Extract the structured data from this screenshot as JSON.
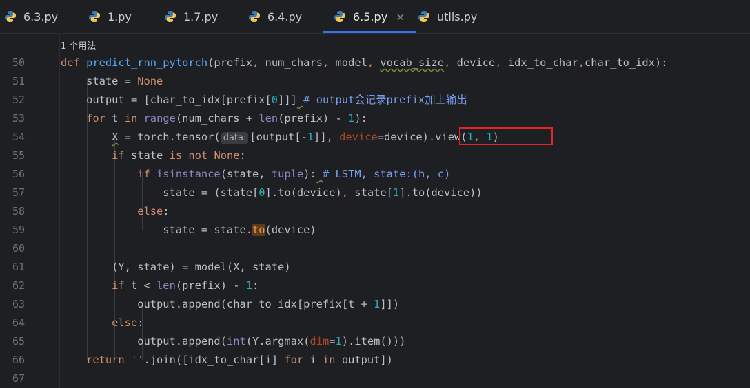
{
  "tabs": [
    {
      "label": "6.3.py",
      "active": false
    },
    {
      "label": "1.py",
      "active": false
    },
    {
      "label": "1.7.py",
      "active": false
    },
    {
      "label": "6.4.py",
      "active": false
    },
    {
      "label": "6.5.py",
      "active": true
    },
    {
      "label": "utils.py",
      "active": false
    }
  ],
  "close_icon": "×",
  "editor": {
    "usage_hint": "1 个用法",
    "line_numbers": [
      "50",
      "51",
      "52",
      "53",
      "54",
      "55",
      "56",
      "57",
      "58",
      "59",
      "60",
      "61",
      "62",
      "63",
      "64",
      "65",
      "66",
      "67"
    ],
    "lines": {
      "l50": {
        "kw": "def",
        "fn": "predict_rnn_pytorch",
        "p1": "(prefix",
        "c1": ", ",
        "a2": "num_chars",
        "c2": ", ",
        "a3": "model",
        "c3": ", ",
        "a4": "vocab_size",
        "c4": ", ",
        "a5": "device",
        "c5": ", ",
        "a6": "idx_to_char",
        "c6": ",",
        "a7": "char_to_idx",
        "end": "):"
      },
      "l51": {
        "a": "state = ",
        "b": "None"
      },
      "l52": {
        "a": "output = [char_to_idx[prefix[",
        "n": "0",
        "b": "]]]",
        "sp": " ",
        "c": "# output会记录prefix加上输出"
      },
      "l53": {
        "k1": "for",
        "a": " t ",
        "k2": "in",
        "s": " ",
        "b1": "range",
        "c": "(num_chars + ",
        "b2": "len",
        "d": "(prefix) - ",
        "n": "1",
        "e": "):"
      },
      "l54": {
        "a": "X",
        "b": " = torch.tensor(",
        "hint": "data:",
        "c": "[output[-",
        "n": "1",
        "d": "]]",
        "e": ", ",
        "f": "device",
        "g": "=device)",
        ".v": ".view(",
        "n1": "1",
        "cm": ", ",
        "n2": "1",
        "end": ")"
      },
      "l55": {
        "k": "if",
        "a": " state ",
        "k2": "is not",
        "s": " ",
        "k3": "None",
        "b": ":"
      },
      "l56": {
        "k": "if",
        "s": " ",
        "b": "isinstance",
        "c": "(state, ",
        "d": "tuple",
        "e": "):",
        "sp": " ",
        "f": "# LSTM, state:(h, c)"
      },
      "l57": {
        "a": "state = (state[",
        "n": "0",
        "b": "].to(device)",
        "c": ", ",
        "d": "state[",
        "n2": "1",
        "e": "].to(device))"
      },
      "l58": {
        "k": "else",
        "b": ":"
      },
      "l59": {
        "a": "state = state.",
        "h": "to",
        "b": "(device)"
      },
      "l60": {},
      "l61": {
        "a": "(Y, state) = model(X, state)"
      },
      "l62": {
        "k": "if",
        "a": " t < ",
        "b": "len",
        "c": "(prefix) - ",
        "n": "1",
        "d": ":"
      },
      "l63": {
        "a": "output.append(char_to_idx[prefix[t + ",
        "n": "1",
        "b": "]])"
      },
      "l64": {
        "k": "else",
        "b": ":"
      },
      "l65": {
        "a": "output.append(",
        "b": "int",
        "c": "(Y.argmax(",
        "d": "dim",
        "e": "=",
        "n": "1",
        "f": ").item()))"
      },
      "l66": {
        "k": "return",
        "s": " ",
        "st": "''",
        "a": ".join([idx_to_char[i] ",
        "k2": "for",
        "b": " i ",
        "k3": "in",
        "c": " output])"
      },
      "l67": {}
    }
  },
  "colors": {
    "keyword": "#cf8e6d",
    "function": "#56a8f5",
    "number": "#2aacb8",
    "builtin": "#8888c6",
    "param": "#aa4926",
    "annotation_box": "#e0262b",
    "active_tab": "#3574f0"
  }
}
